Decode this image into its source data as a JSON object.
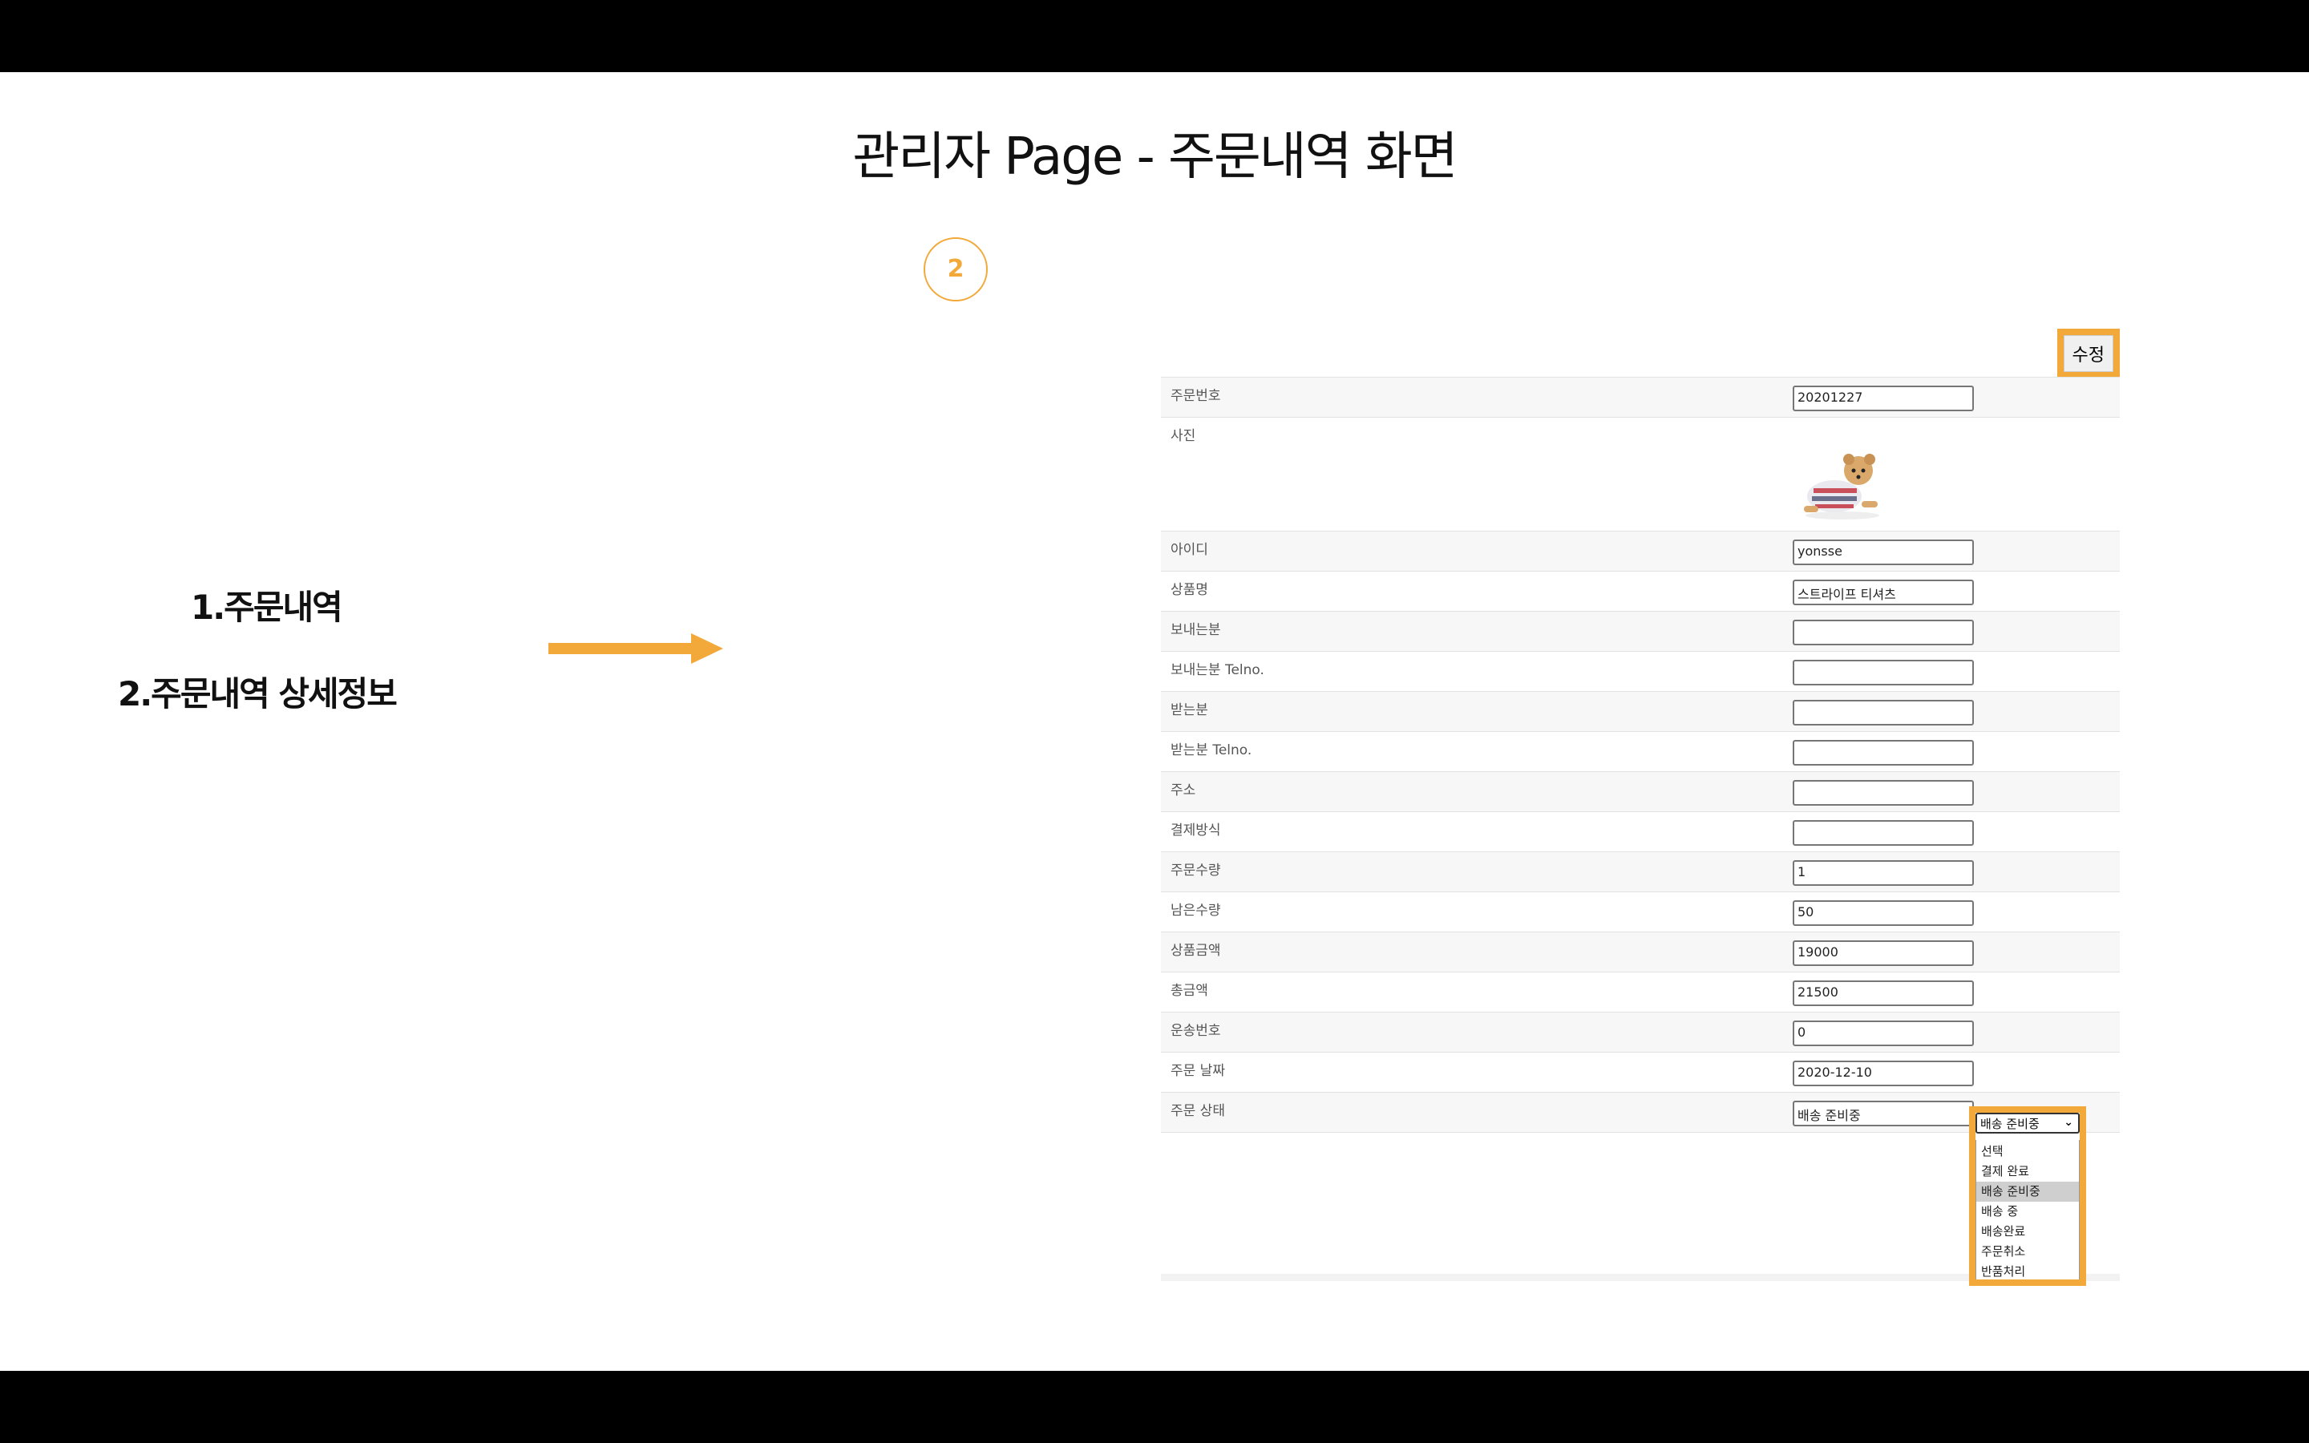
{
  "slide": {
    "title": "관리자 Page - 주문내역 화면",
    "step_number": "2",
    "menu_items": [
      "1.주문내역",
      "2.주문내역 상세정보"
    ],
    "accent_color": "#f3a93a"
  },
  "panel": {
    "edit_button": "수정",
    "rows": [
      {
        "label": "주문번호",
        "value": "20201227"
      },
      {
        "label": "사진",
        "value": ""
      },
      {
        "label": "아이디",
        "value": "yonsse"
      },
      {
        "label": "상품명",
        "value": "스트라이프 티셔츠"
      },
      {
        "label": "보내는분",
        "value": ""
      },
      {
        "label": "보내는분 Telno.",
        "value": ""
      },
      {
        "label": "받는분",
        "value": ""
      },
      {
        "label": "받는분 Telno.",
        "value": ""
      },
      {
        "label": "주소",
        "value": ""
      },
      {
        "label": "결제방식",
        "value": ""
      },
      {
        "label": "주문수량",
        "value": "1"
      },
      {
        "label": "남은수량",
        "value": "50"
      },
      {
        "label": "상품금액",
        "value": "19000"
      },
      {
        "label": "총금액",
        "value": "21500"
      },
      {
        "label": "운송번호",
        "value": "0"
      },
      {
        "label": "주문 날짜",
        "value": "2020-12-10"
      },
      {
        "label": "주문 상태",
        "value": "배송 준비중"
      }
    ],
    "status_select": {
      "selected": "배송 준비중",
      "options": [
        "선택",
        "결제 완료",
        "배송 준비중",
        "배송 중",
        "배송완료",
        "주문취소",
        "반품처리"
      ]
    }
  }
}
